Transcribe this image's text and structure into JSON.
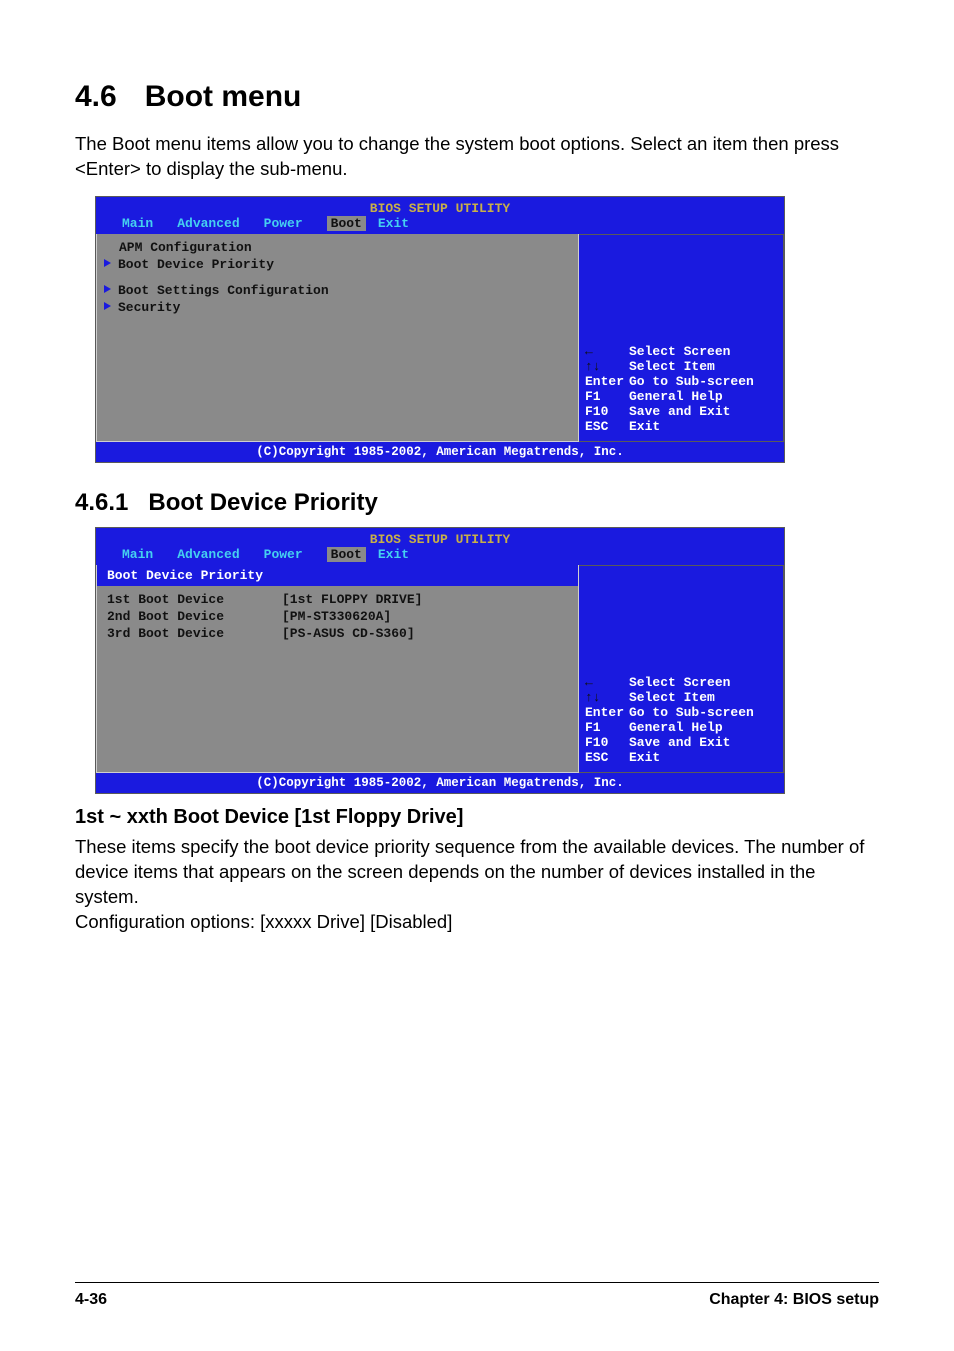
{
  "section": {
    "number": "4.6",
    "title": "Boot menu"
  },
  "intro": "The Boot menu items allow you to change the system boot options. Select an item then press <Enter> to display the sub-menu.",
  "bios": {
    "header": "BIOS SETUP UTILITY",
    "tabs": [
      "Main",
      "Advanced",
      "Power",
      "Boot",
      "Exit"
    ],
    "active_tab": "Boot",
    "copyright": "(C)Copyright 1985-2002, American Megatrends, Inc.",
    "help": [
      {
        "icon": "←",
        "text": "Select Screen"
      },
      {
        "icon": "↑↓",
        "text": "Select Item"
      },
      {
        "key": "Enter",
        "text": "Go to Sub-screen"
      },
      {
        "key": "F1",
        "text": "General Help"
      },
      {
        "key": "F10",
        "text": "Save and Exit"
      },
      {
        "key": "ESC",
        "text": "Exit"
      }
    ]
  },
  "screen1": {
    "items": [
      {
        "label": "APM Configuration",
        "arrow": false
      },
      {
        "label": "Boot Device Priority",
        "arrow": true
      },
      {
        "label": "Boot Settings Configuration",
        "arrow": true,
        "gap": true
      },
      {
        "label": "Security",
        "arrow": true
      }
    ]
  },
  "subsection": {
    "number": "4.6.1",
    "title": "Boot Device Priority"
  },
  "screen2": {
    "header": "Boot Device Priority",
    "fields": [
      {
        "label": "1st Boot Device",
        "value": "[1st FLOPPY DRIVE]"
      },
      {
        "label": "2nd Boot Device",
        "value": "[PM-ST330620A]"
      },
      {
        "label": "3rd Boot Device",
        "value": "[PS-ASUS CD-S360]"
      }
    ]
  },
  "subsub": {
    "title": "1st ~ xxth Boot Device [1st Floppy Drive]"
  },
  "desc1": "These items specify the boot device priority sequence from the available devices. The number of device items that appears on the screen depends on the number of devices installed in the system.",
  "desc2": "Configuration options: [xxxxx Drive] [Disabled]",
  "footer": {
    "left": "4-36",
    "right": "Chapter 4: BIOS setup"
  }
}
